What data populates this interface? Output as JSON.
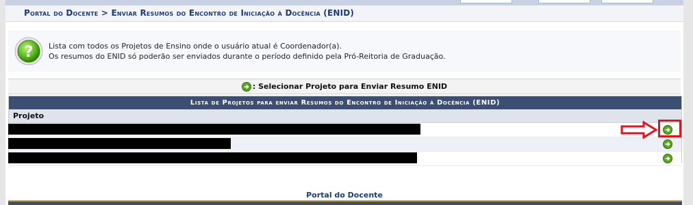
{
  "breadcrumb": {
    "root": "Portal do Docente",
    "separator": " > ",
    "current": "Enviar Resumos do Encontro de Iniciação à Docência (ENID)"
  },
  "info": {
    "icon": "help-question-icon",
    "line1": "Lista com todos os Projetos de Ensino onde o usuário atual é Coordenador(a).",
    "line2": "Os resumos do ENID só poderão ser enviados durante o período definido pela Pró-Reitoria de Graduação."
  },
  "legend": {
    "icon": "green-arrow-right-icon",
    "label": ": Selecionar Projeto para Enviar Resumo ENID"
  },
  "table": {
    "caption": "Lista de Projetos para enviar Resumos do Encontro de Iniciação à Docência (ENID)",
    "column_header": "Projeto",
    "rows": [
      {
        "project": "",
        "redacted": true,
        "action_icon": "green-arrow-right-icon"
      },
      {
        "project": "",
        "redacted": true,
        "action_icon": "green-arrow-right-icon"
      },
      {
        "project": "",
        "redacted": true,
        "action_icon": "green-arrow-right-icon"
      }
    ]
  },
  "annotation": {
    "arrow_icon": "red-arrow-right-icon",
    "highlight_color": "#e5121b"
  },
  "footer": {
    "link": "Portal do Docente"
  },
  "colors": {
    "title_text": "#1a3c7d",
    "caption_bg": "#3c4e73",
    "header_bg": "#dfe4ec",
    "row_alt_bg": "#edf1f7"
  }
}
